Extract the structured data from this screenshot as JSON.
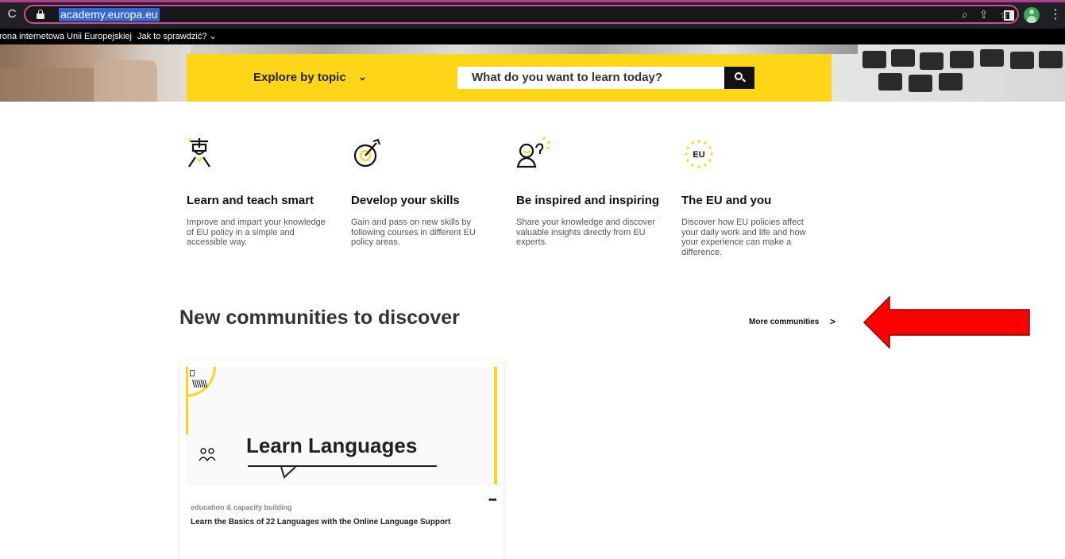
{
  "browser": {
    "url": "academy.europa.eu",
    "reload_glyph": "C",
    "toolbar_icons": [
      "zoom-icon",
      "share-icon",
      "bookmark-star-icon",
      "side-panel-icon",
      "profile-avatar",
      "menu-icon"
    ]
  },
  "eu_bar": {
    "official_text": "trona internetowa Unii Europejskiej",
    "check_link": "Jak to sprawdzić? ⌄"
  },
  "search_bar": {
    "explore_label": "Explore by topic",
    "explore_chevron": "⌄",
    "placeholder": "What do you want to learn today?"
  },
  "features": [
    {
      "icon": "graduate-icon",
      "title": "Learn and teach smart",
      "text": "Improve and impart your knowledge of EU policy in a simple and accessible way."
    },
    {
      "icon": "target-icon",
      "title": "Develop your skills",
      "text": "Gain and pass on new skills by following courses in different EU policy areas."
    },
    {
      "icon": "idea-person-icon",
      "title": "Be inspired and inspiring",
      "text": "Share your knowledge and discover valuable insights directly from EU experts."
    },
    {
      "icon": "eu-stars-icon",
      "title": "The EU and you",
      "text": "Discover how EU policies affect your daily work and life and how your experience can make a difference.",
      "badge": "EU"
    }
  ],
  "communities": {
    "heading": "New communities to discover",
    "more_label": "More communities",
    "more_chevron": ">",
    "cards": [
      {
        "image_title": "Learn Languages",
        "hatch": "\\\\\\\\\\\\\\",
        "category": "education & capacity building",
        "name": "Learn the Basics of 22 Languages with the Online Language Support",
        "menu": "•••"
      }
    ]
  },
  "colors": {
    "accent_yellow": "#ffd617",
    "annotation_arrow": "#ff0000",
    "chrome_bg": "#202124"
  }
}
